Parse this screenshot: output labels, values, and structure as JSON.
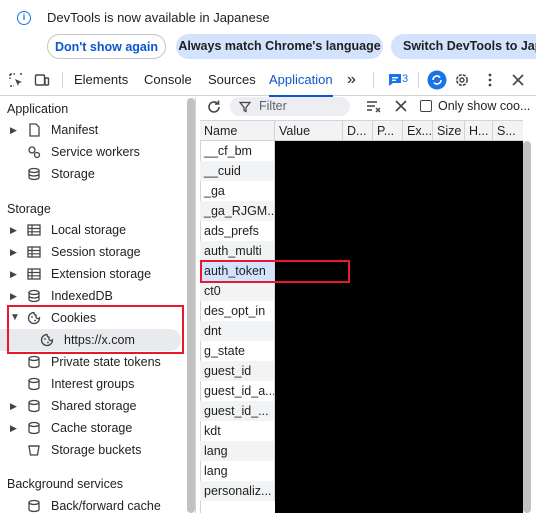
{
  "banner": {
    "message": "DevTools is now available in Japanese",
    "dont_show": "Don't show again",
    "match_language": "Always match Chrome's language",
    "switch": "Switch DevTools to Japanese"
  },
  "tabs": {
    "elements": "Elements",
    "console": "Console",
    "sources": "Sources",
    "application": "Application",
    "more": "»",
    "issues_count": "3"
  },
  "sidebar": {
    "application_header": "Application",
    "application_items": [
      "Manifest",
      "Service workers",
      "Storage"
    ],
    "storage_header": "Storage",
    "storage_items": [
      "Local storage",
      "Session storage",
      "Extension storage",
      "IndexedDB",
      "Cookies",
      "https://x.com",
      "Private state tokens",
      "Interest groups",
      "Shared storage",
      "Cache storage",
      "Storage buckets"
    ],
    "background_header": "Background services",
    "background_items": [
      "Back/forward cache"
    ]
  },
  "toolbar": {
    "filter_placeholder": "Filter",
    "only_show": "Only show coo..."
  },
  "table": {
    "columns": [
      "Name",
      "Value",
      "D...",
      "P...",
      "Ex...",
      "Size",
      "H...",
      "S..."
    ],
    "names": [
      "__cf_bm",
      "__cuid",
      "_ga",
      "_ga_RJGM...",
      "ads_prefs",
      "auth_multi",
      "auth_token",
      "ct0",
      "des_opt_in",
      "dnt",
      "g_state",
      "guest_id",
      "guest_id_a...",
      "guest_id_...",
      "kdt",
      "lang",
      "lang",
      "personaliz..."
    ]
  },
  "colors": {
    "accent": "#0b57d0",
    "highlight": "#e8192c",
    "redacted": "#000000"
  }
}
